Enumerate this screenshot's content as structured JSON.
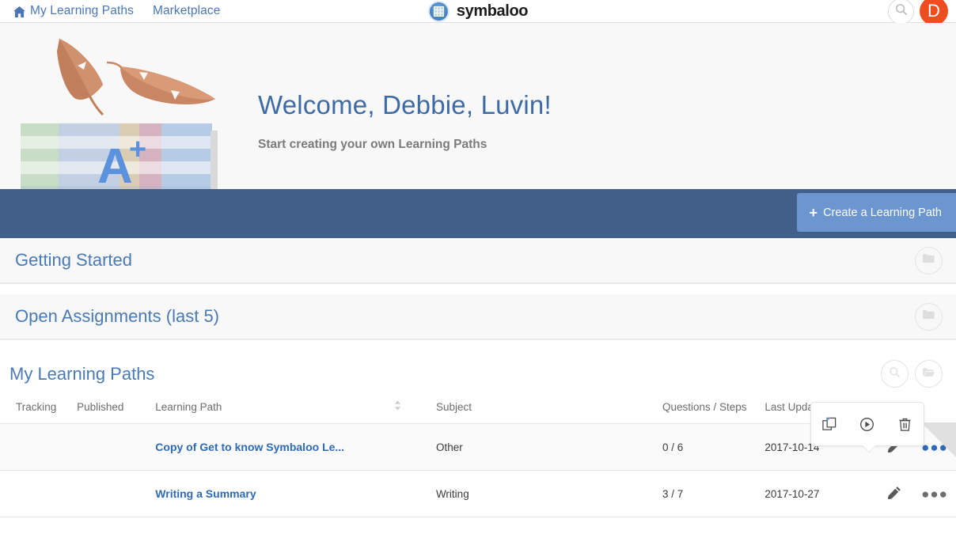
{
  "nav": {
    "home_icon": "home-icon",
    "items": [
      {
        "label": "My Learning Paths"
      },
      {
        "label": "Marketplace"
      }
    ],
    "brand": "symbaloo",
    "search_icon": "search-icon",
    "avatar_initial": "D"
  },
  "hero": {
    "title": "Welcome, Debbie, Luvin!",
    "subtitle": "Start creating your own Learning Paths",
    "art_letter": "A",
    "art_plus": "+"
  },
  "actionbar": {
    "create_label": "Create a Learning Path",
    "create_plus": "+"
  },
  "sections": [
    {
      "title": "Getting Started",
      "folder_icon": "folder-icon"
    },
    {
      "title": "Open Assignments (last 5)",
      "folder_icon": "folder-icon"
    }
  ],
  "learning_paths": {
    "title": "My Learning Paths",
    "search_icon": "search-icon",
    "folder_icon": "folder-open-icon",
    "columns": {
      "tracking": "Tracking",
      "published": "Published",
      "name": "Learning Path",
      "subject": "Subject",
      "questions": "Questions / Steps",
      "last_update": "Last Update"
    },
    "rows": [
      {
        "tracking": "",
        "published": "",
        "name": "Copy of Get to know Symbaloo Le...",
        "subject": "Other",
        "questions": "0 / 6",
        "last_update": "2017-10-14",
        "edit_icon": "pencil-icon",
        "more_icon": "ellipsis-icon",
        "more_state": "active"
      },
      {
        "tracking": "",
        "published": "",
        "name": "Writing a Summary",
        "subject": "Writing",
        "questions": "3 / 7",
        "last_update": "2017-10-27",
        "edit_icon": "pencil-icon",
        "more_icon": "ellipsis-icon",
        "more_state": "idle"
      }
    ]
  },
  "popup_menu": {
    "copy_icon": "copy-icon",
    "play_icon": "play-icon",
    "delete_icon": "trash-icon"
  },
  "colors": {
    "accent_blue": "#4a7ab5",
    "band_blue": "#415f89",
    "button_blue": "#6b96cf",
    "avatar_orange": "#ef4d20",
    "link_blue": "#2e6ab5"
  }
}
